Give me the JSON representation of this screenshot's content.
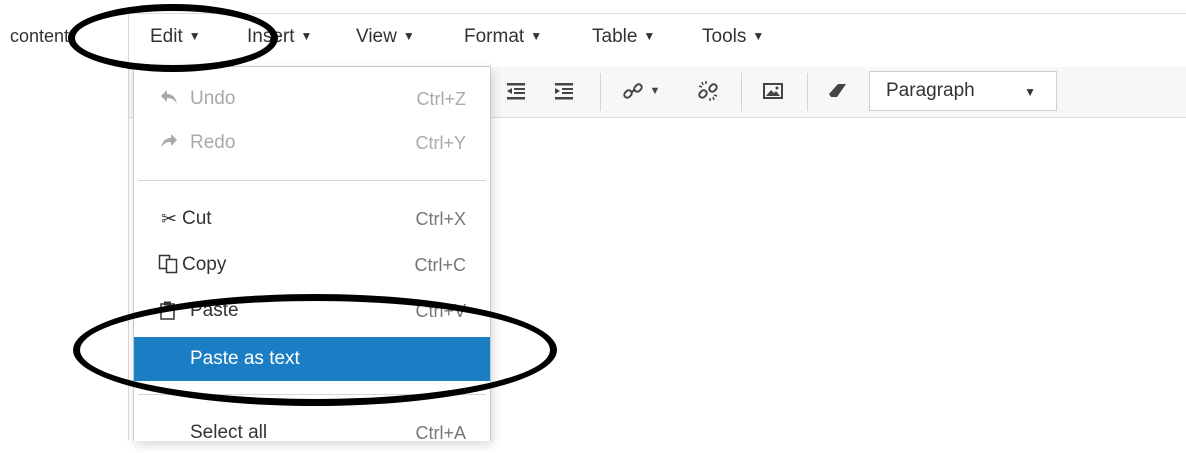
{
  "page": {
    "label": "content"
  },
  "menubar": {
    "items": [
      {
        "label": "Edit"
      },
      {
        "label": "Insert"
      },
      {
        "label": "View"
      },
      {
        "label": "Format"
      },
      {
        "label": "Table"
      },
      {
        "label": "Tools"
      }
    ]
  },
  "toolbar": {
    "format_select": "Paragraph"
  },
  "edit_menu": {
    "undo": {
      "label": "Undo",
      "shortcut": "Ctrl+Z"
    },
    "redo": {
      "label": "Redo",
      "shortcut": "Ctrl+Y"
    },
    "cut": {
      "label": "Cut",
      "shortcut": "Ctrl+X"
    },
    "copy": {
      "label": "Copy",
      "shortcut": "Ctrl+C"
    },
    "paste": {
      "label": "Paste",
      "shortcut": "Ctrl+V"
    },
    "paste_as_text": {
      "label": "Paste as text"
    },
    "select_all": {
      "label": "Select all",
      "shortcut": "Ctrl+A"
    }
  },
  "colors": {
    "highlight": "#1b7ec5",
    "annotation": "#000000"
  },
  "icons": [
    "undo-icon",
    "redo-icon",
    "cut-icon",
    "copy-icon",
    "paste-icon",
    "outdent-icon",
    "indent-icon",
    "link-icon",
    "unlink-icon",
    "image-icon",
    "eraser-icon"
  ]
}
